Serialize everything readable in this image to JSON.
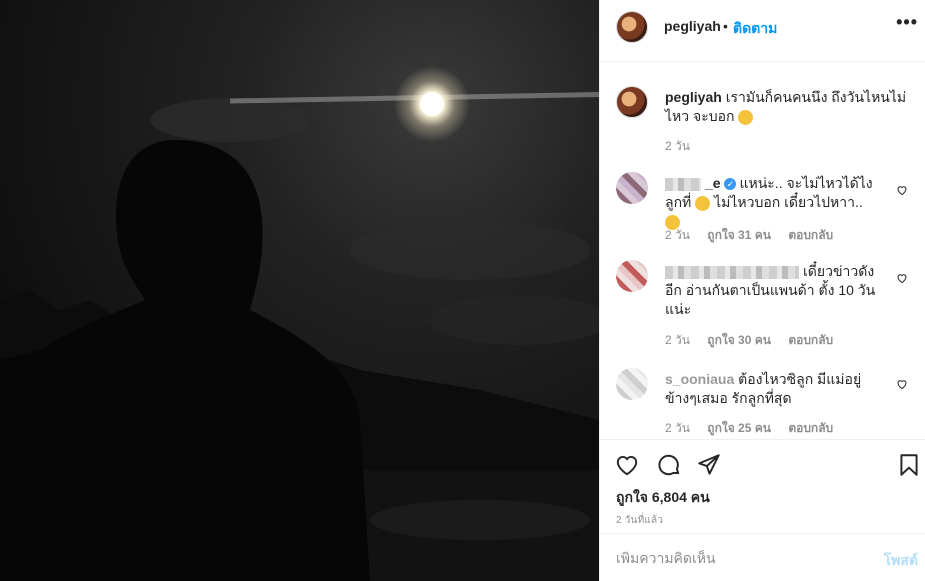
{
  "post": {
    "username": "pegliyah",
    "follow_label": "ติดตาม",
    "header_dot": "•",
    "more_label": "•••",
    "caption_text": "เรามันก็คนคนนึง ถึงวันไหนไม่ไหว จะบอก",
    "caption_time": "2 วัน",
    "likes": "ถูกใจ 6,804 คน",
    "posted_ago": "2 วันที่แล้ว",
    "add_comment_placeholder": "เพิ่มความคิดเห็น",
    "post_button": "โพสต์"
  },
  "comments": [
    {
      "username_visible": "_e",
      "verified": true,
      "text": "แหน่ะ.. จะไม่ไหวได้ไง ลูกที่",
      "text2": " ไม่ไหวบอก เดี๋ยวไปหาา..",
      "time": "2 วัน",
      "likes": "ถูกใจ 31 คน",
      "reply": "ตอบกลับ"
    },
    {
      "username_visible": "",
      "verified": false,
      "text": "เดี๋ยวข่าวดังอีก อ่านกันตาเป็นแพนด้า ตั้ง 10 วันแน่ะ",
      "time": "2 วัน",
      "likes": "ถูกใจ 30 คน",
      "reply": "ตอบกลับ"
    },
    {
      "username_visible": "s_ooniaua",
      "verified": false,
      "text": "ต้องไหวซิลูก มีแม่อยู่ข้างๆเสมอ รักลูกที่สุด",
      "time": "2 วัน",
      "likes": "ถูกใจ 25 คน",
      "reply": "ตอบกลับ"
    }
  ],
  "icons": [
    "heart-icon",
    "comment-icon",
    "share-icon",
    "bookmark-icon",
    "verified-icon",
    "more-icon"
  ],
  "colors": {
    "link_blue": "#0095f6",
    "muted": "#8e8e8e",
    "post_disabled": "#b2dffc"
  }
}
